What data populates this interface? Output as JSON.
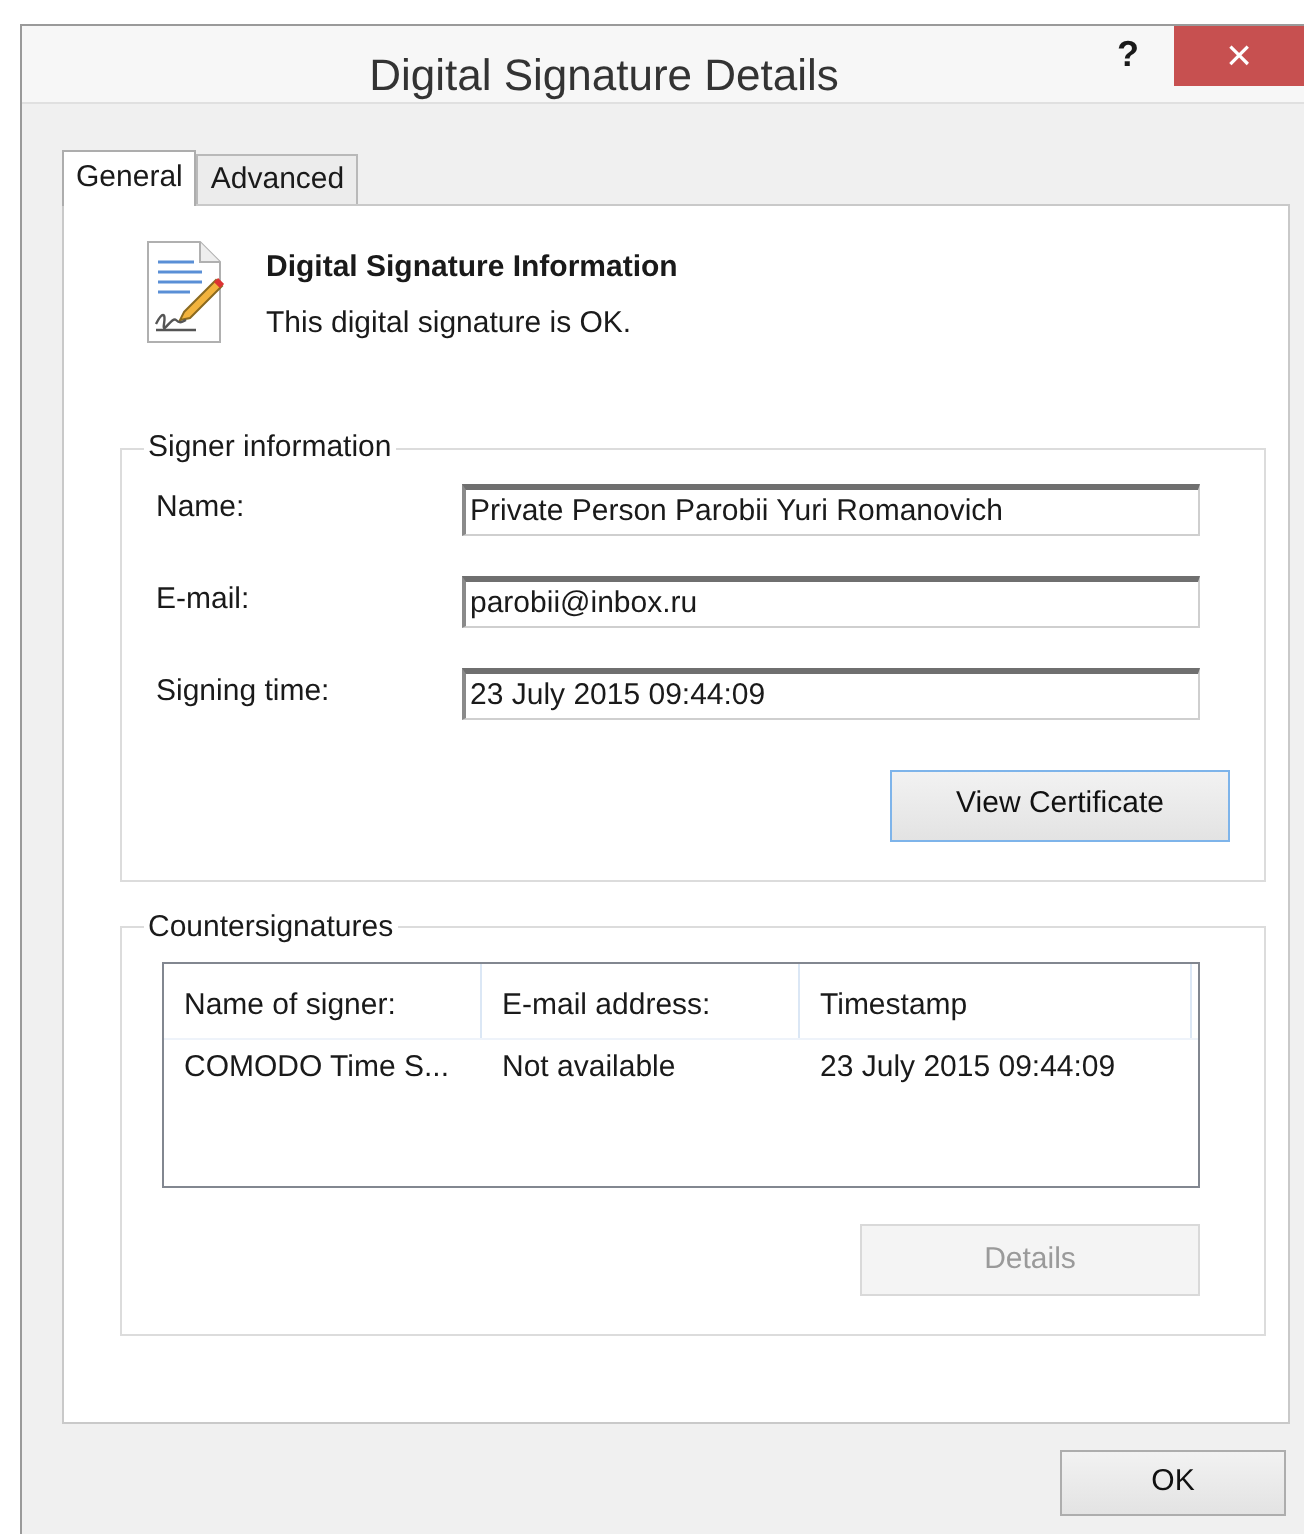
{
  "window": {
    "title": "Digital Signature Details",
    "help": "?",
    "close": "×"
  },
  "tabs": [
    {
      "label": "General",
      "selected": true
    },
    {
      "label": "Advanced",
      "selected": false
    }
  ],
  "header": {
    "title": "Digital Signature Information",
    "subtitle": "This digital signature is OK."
  },
  "signer_information": {
    "title": "Signer information",
    "fields": [
      {
        "label": "Name:",
        "value": "Private Person Parobii Yuri Romanovich"
      },
      {
        "label": "E-mail:",
        "value": "parobii@inbox.ru"
      },
      {
        "label": "Signing time:",
        "value": "23 July 2015 09:44:09"
      }
    ],
    "button": {
      "label": "View Certificate",
      "disabled": false
    }
  },
  "countersignatures": {
    "title": "Countersignatures",
    "columns": [
      "Name of signer:",
      "E-mail address:",
      "Timestamp"
    ],
    "rows": [
      [
        "COMODO Time S...",
        "Not available",
        "23 July 2015 09:44:09"
      ]
    ],
    "button": {
      "label": "Details",
      "disabled": true
    }
  },
  "ok_button": {
    "label": "OK",
    "disabled": false
  }
}
